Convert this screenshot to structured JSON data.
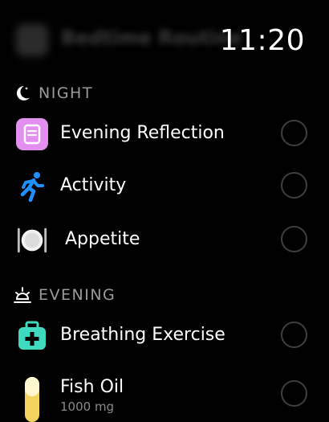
{
  "header": {
    "app_title": "Bedtime Routine",
    "time": "11:20"
  },
  "sections": [
    {
      "title": "NIGHT",
      "icon": "moon-star-icon",
      "items": [
        {
          "label": "Evening Reflection",
          "icon": "journal-icon",
          "color": "#e28ff0"
        },
        {
          "label": "Activity",
          "icon": "running-figure-icon",
          "color": "#1e90ff"
        },
        {
          "label": "Appetite",
          "icon": "plate-utensils-icon",
          "color": "#e8e8e8"
        }
      ]
    },
    {
      "title": "EVENING",
      "icon": "sunset-icon",
      "items": [
        {
          "label": "Breathing Exercise",
          "icon": "first-aid-kit-icon",
          "color": "#3fd9c0"
        },
        {
          "label": "Fish Oil",
          "sublabel": "1000 mg",
          "icon": "capsule-icon",
          "color": "#f4d35e"
        }
      ]
    }
  ],
  "colors": {
    "background": "#000000",
    "section_header": "#9b9b9b",
    "checkbox_ring": "#3f3f3f"
  }
}
